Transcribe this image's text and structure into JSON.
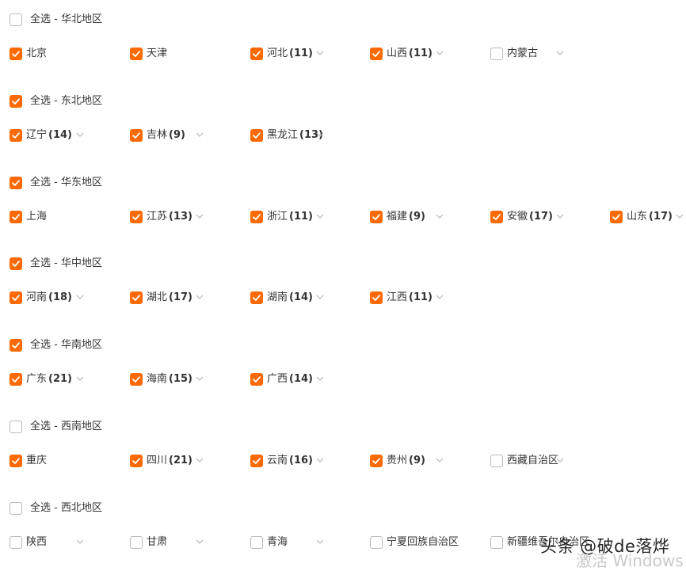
{
  "accent": "#ff6a00",
  "regions": [
    {
      "label": "全选 - 华北地区",
      "checked": false,
      "provinces": [
        {
          "name": "北京",
          "count": "",
          "checked": true,
          "dropdown": false
        },
        {
          "name": "天津",
          "count": "",
          "checked": true,
          "dropdown": false
        },
        {
          "name": "河北",
          "count": "(11)",
          "checked": true,
          "dropdown": true
        },
        {
          "name": "山西",
          "count": "(11)",
          "checked": true,
          "dropdown": true
        },
        {
          "name": "内蒙古",
          "count": "",
          "checked": false,
          "dropdown": true
        }
      ]
    },
    {
      "label": "全选 - 东北地区",
      "checked": true,
      "provinces": [
        {
          "name": "辽宁",
          "count": "(14)",
          "checked": true,
          "dropdown": true
        },
        {
          "name": "吉林",
          "count": "(9)",
          "checked": true,
          "dropdown": true
        },
        {
          "name": "黑龙江",
          "count": "(13)",
          "checked": true,
          "dropdown": true
        }
      ]
    },
    {
      "label": "全选 - 华东地区",
      "checked": true,
      "provinces": [
        {
          "name": "上海",
          "count": "",
          "checked": true,
          "dropdown": false
        },
        {
          "name": "江苏",
          "count": "(13)",
          "checked": true,
          "dropdown": true
        },
        {
          "name": "浙江",
          "count": "(11)",
          "checked": true,
          "dropdown": true
        },
        {
          "name": "福建",
          "count": "(9)",
          "checked": true,
          "dropdown": true
        },
        {
          "name": "安徽",
          "count": "(17)",
          "checked": true,
          "dropdown": true
        },
        {
          "name": "山东",
          "count": "(17)",
          "checked": true,
          "dropdown": true
        }
      ]
    },
    {
      "label": "全选 - 华中地区",
      "checked": true,
      "provinces": [
        {
          "name": "河南",
          "count": "(18)",
          "checked": true,
          "dropdown": true
        },
        {
          "name": "湖北",
          "count": "(17)",
          "checked": true,
          "dropdown": true
        },
        {
          "name": "湖南",
          "count": "(14)",
          "checked": true,
          "dropdown": true
        },
        {
          "name": "江西",
          "count": "(11)",
          "checked": true,
          "dropdown": true
        }
      ]
    },
    {
      "label": "全选 - 华南地区",
      "checked": true,
      "provinces": [
        {
          "name": "广东",
          "count": "(21)",
          "checked": true,
          "dropdown": true
        },
        {
          "name": "海南",
          "count": "(15)",
          "checked": true,
          "dropdown": true
        },
        {
          "name": "广西",
          "count": "(14)",
          "checked": true,
          "dropdown": true
        }
      ]
    },
    {
      "label": "全选 - 西南地区",
      "checked": false,
      "provinces": [
        {
          "name": "重庆",
          "count": "",
          "checked": true,
          "dropdown": false
        },
        {
          "name": "四川",
          "count": "(21)",
          "checked": true,
          "dropdown": true
        },
        {
          "name": "云南",
          "count": "(16)",
          "checked": true,
          "dropdown": true
        },
        {
          "name": "贵州",
          "count": "(9)",
          "checked": true,
          "dropdown": true
        },
        {
          "name": "西藏自治区",
          "count": "",
          "checked": false,
          "dropdown": true
        }
      ]
    },
    {
      "label": "全选 - 西北地区",
      "checked": false,
      "provinces": [
        {
          "name": "陕西",
          "count": "",
          "checked": false,
          "dropdown": true
        },
        {
          "name": "甘肃",
          "count": "",
          "checked": false,
          "dropdown": true
        },
        {
          "name": "青海",
          "count": "",
          "checked": false,
          "dropdown": true
        },
        {
          "name": "宁夏回族自治区",
          "count": "",
          "checked": false,
          "dropdown": true
        },
        {
          "name": "新疆维吾尔自治区",
          "count": "",
          "checked": false,
          "dropdown": true
        }
      ]
    }
  ],
  "overlay": {
    "watermark": "头条 @破de落烨",
    "activate": "激活 Windows"
  }
}
